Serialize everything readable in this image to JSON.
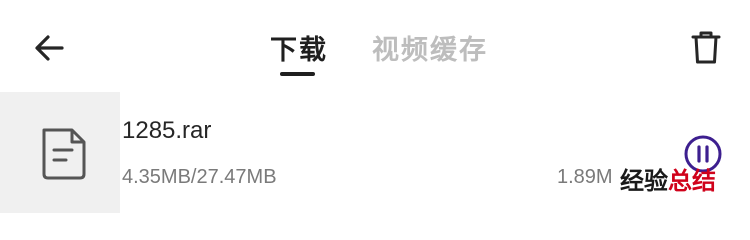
{
  "header": {
    "back_icon": "arrow-left-icon",
    "tabs": [
      {
        "label": "下载",
        "active": true
      },
      {
        "label": "视频缓存",
        "active": false
      }
    ],
    "delete_icon": "trash-icon"
  },
  "download": {
    "file_icon": "document-icon",
    "name": "1285.rar",
    "progress_text": "4.35MB/27.47MB",
    "speed": "1.89M",
    "action_icon": "pause-icon",
    "accent_color": "#3d1f8f"
  },
  "watermark": {
    "text_part1": "经验",
    "text_part2": "总结"
  },
  "colors": {
    "active_tab": "#1f1f1f",
    "inactive_tab": "#bdbdbd",
    "thumb_background": "#f0f0f0",
    "secondary_text": "#7a7a7a"
  }
}
